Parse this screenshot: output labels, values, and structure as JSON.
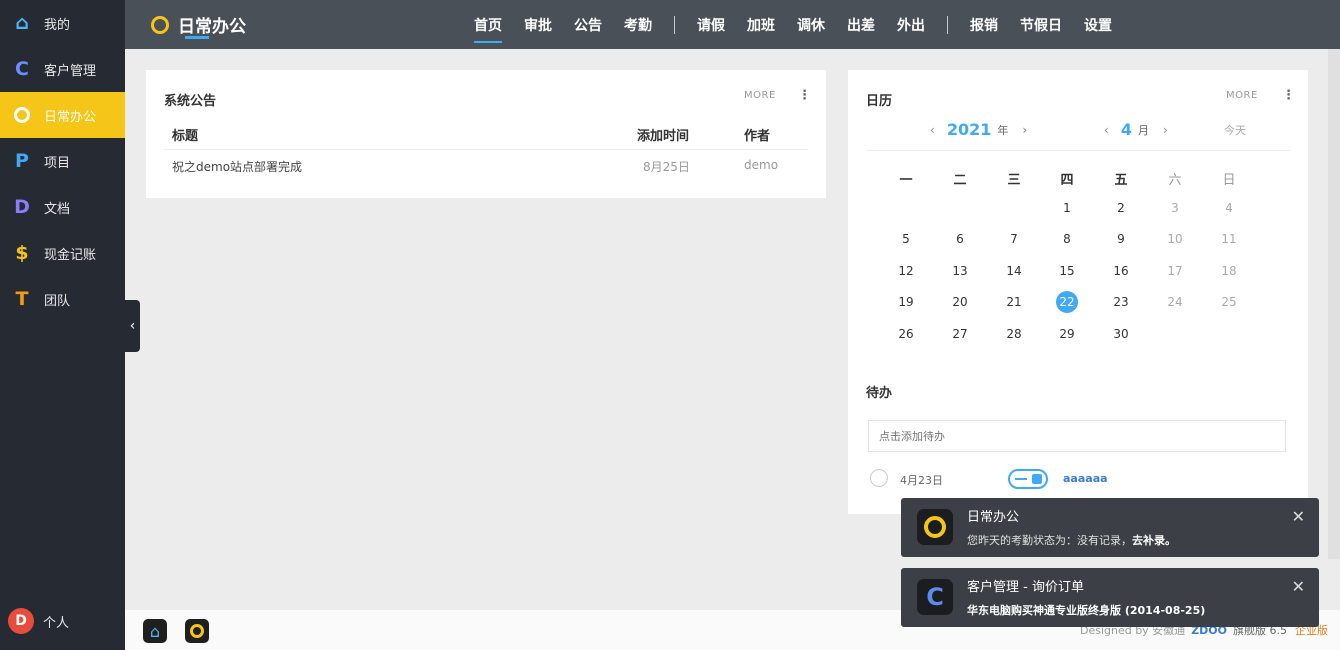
{
  "sidebar": {
    "items": [
      {
        "label": "我的",
        "icon": "home-icon",
        "glyph": "⌂",
        "color": "#4fb3f6"
      },
      {
        "label": "客户管理",
        "icon": "letter-c-icon",
        "glyph": "C",
        "color": "#6c8cff"
      },
      {
        "label": "日常办公",
        "icon": "ring-icon",
        "glyph": "",
        "color": "#ffffff"
      },
      {
        "label": "项目",
        "icon": "letter-p-icon",
        "glyph": "P",
        "color": "#3fa9f5"
      },
      {
        "label": "文档",
        "icon": "letter-d-icon",
        "glyph": "D",
        "color": "#8a7bff"
      },
      {
        "label": "现金记账",
        "icon": "dollar-icon",
        "glyph": "$",
        "color": "#f5c518"
      },
      {
        "label": "团队",
        "icon": "letter-t-icon",
        "glyph": "T",
        "color": "#f39c12"
      }
    ],
    "user": {
      "avatar": "D",
      "label": "个人"
    }
  },
  "header": {
    "app_title": "日常办公",
    "nav": [
      "首页",
      "审批",
      "公告",
      "考勤",
      "请假",
      "加班",
      "调休",
      "出差",
      "外出",
      "报销",
      "节假日",
      "设置"
    ]
  },
  "notice": {
    "title": "系统公告",
    "more": "MORE",
    "columns": [
      "标题",
      "添加时间",
      "作者"
    ],
    "rows": [
      {
        "title": "祝之demo站点部署完成",
        "time": "8月25日",
        "author": "demo"
      }
    ]
  },
  "calendar": {
    "title": "日历",
    "more": "MORE",
    "year": "2021",
    "year_unit": "年",
    "month": "4",
    "month_unit": "月",
    "today_label": "今天",
    "weekdays": [
      "一",
      "二",
      "三",
      "四",
      "五",
      "六",
      "日"
    ],
    "days": [
      "1",
      "2",
      "3",
      "4",
      "5",
      "6",
      "7",
      "8",
      "9",
      "10",
      "11",
      "12",
      "13",
      "14",
      "15",
      "16",
      "17",
      "18",
      "19",
      "20",
      "21",
      "22",
      "23",
      "24",
      "25",
      "26",
      "27",
      "28",
      "29",
      "30"
    ],
    "first_weekday_index": 3,
    "today": "22"
  },
  "todo": {
    "title": "待办",
    "placeholder": "点击添加待办",
    "items": [
      {
        "date": "4月23日",
        "text": "aaaaaa"
      }
    ]
  },
  "notifications": [
    {
      "title": "日常办公",
      "body_prefix": "您昨天的考勤状态为：没有记录，",
      "body_link": "去补录。",
      "icon": "ring-icon"
    },
    {
      "title": "客户管理 - 询价订单",
      "body_prefix": "",
      "body_link": "华东电脑购买神通专业版终身版 (2014-08-25)",
      "icon": "letter-c-icon"
    }
  ],
  "footer": {
    "powered": "Designed by 安徽通",
    "brand": "ZDOO",
    "version": "旗舰版 6.5",
    "link": "企业版"
  }
}
